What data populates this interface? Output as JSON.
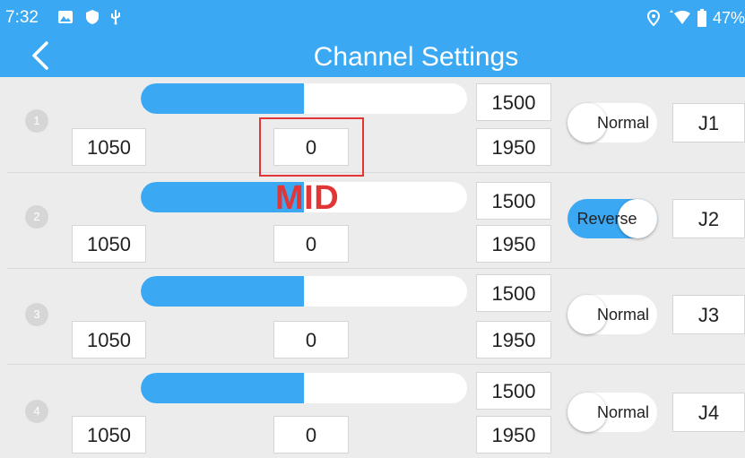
{
  "status_bar": {
    "time": "7:32",
    "battery": "47%"
  },
  "header": {
    "title": "Channel Settings"
  },
  "annotation": {
    "label": "MID"
  },
  "channels": [
    {
      "num": "1",
      "min": "1050",
      "mid": "0",
      "center": "1500",
      "max": "1950",
      "direction": "Normal",
      "reversed": false,
      "assignment": "J1",
      "fill_fraction": 0.5
    },
    {
      "num": "2",
      "min": "1050",
      "mid": "0",
      "center": "1500",
      "max": "1950",
      "direction": "Reverse",
      "reversed": true,
      "assignment": "J2",
      "fill_fraction": 0.5
    },
    {
      "num": "3",
      "min": "1050",
      "mid": "0",
      "center": "1500",
      "max": "1950",
      "direction": "Normal",
      "reversed": false,
      "assignment": "J3",
      "fill_fraction": 0.5
    },
    {
      "num": "4",
      "min": "1050",
      "mid": "0",
      "center": "1500",
      "max": "1950",
      "direction": "Normal",
      "reversed": false,
      "assignment": "J4",
      "fill_fraction": 0.5
    }
  ],
  "colors": {
    "accent": "#3aa8f2",
    "annotation": "#e23535",
    "background": "#ececec"
  }
}
